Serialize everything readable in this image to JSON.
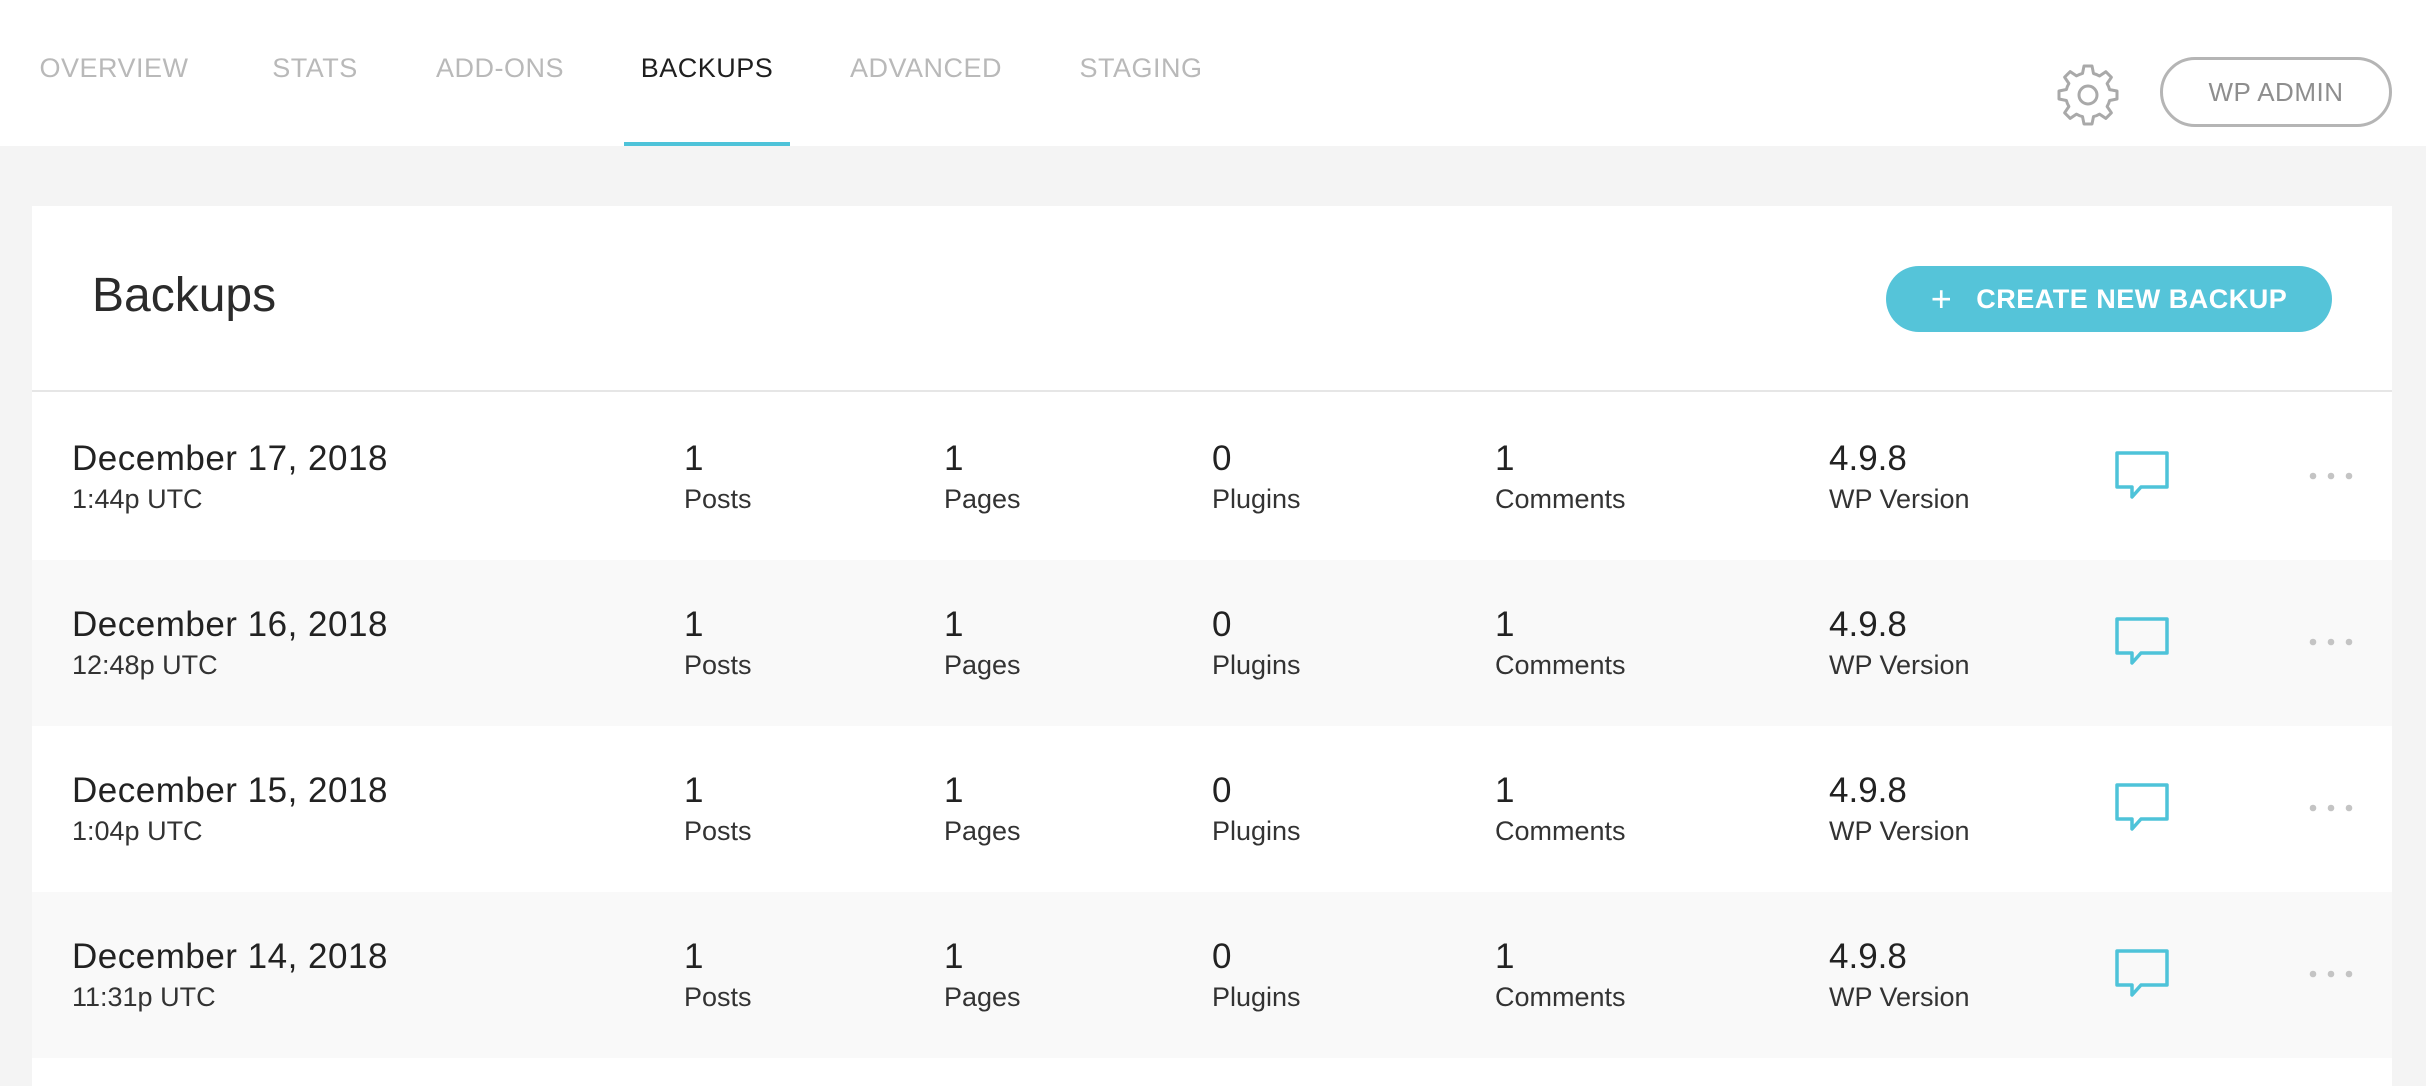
{
  "nav": {
    "tabs": [
      {
        "label": "OVERVIEW"
      },
      {
        "label": "STATS"
      },
      {
        "label": "ADD-ONS"
      },
      {
        "label": "BACKUPS"
      },
      {
        "label": "ADVANCED"
      },
      {
        "label": "STAGING"
      }
    ],
    "active_tab": "BACKUPS",
    "wp_admin_label": "WP ADMIN",
    "settings_icon": "gear-icon"
  },
  "colors": {
    "accent": "#55c4d9",
    "tab_inactive": "#b9b9b9",
    "row_alt": "#f9f9f9"
  },
  "backups": {
    "title": "Backups",
    "create_label": "CREATE NEW BACKUP",
    "create_icon": "plus-icon",
    "rows": [
      {
        "date": "December 17, 2018",
        "time": "1:44p UTC",
        "posts": "1",
        "posts_label": "Posts",
        "pages": "1",
        "pages_label": "Pages",
        "plugins": "0",
        "plugins_label": "Plugins",
        "comments": "1",
        "comments_label": "Comments",
        "wp_version": "4.9.8",
        "wp_version_label": "WP Version"
      },
      {
        "date": "December 16, 2018",
        "time": "12:48p UTC",
        "posts": "1",
        "posts_label": "Posts",
        "pages": "1",
        "pages_label": "Pages",
        "plugins": "0",
        "plugins_label": "Plugins",
        "comments": "1",
        "comments_label": "Comments",
        "wp_version": "4.9.8",
        "wp_version_label": "WP Version"
      },
      {
        "date": "December 15, 2018",
        "time": "1:04p UTC",
        "posts": "1",
        "posts_label": "Posts",
        "pages": "1",
        "pages_label": "Pages",
        "plugins": "0",
        "plugins_label": "Plugins",
        "comments": "1",
        "comments_label": "Comments",
        "wp_version": "4.9.8",
        "wp_version_label": "WP Version"
      },
      {
        "date": "December 14, 2018",
        "time": "11:31p UTC",
        "posts": "1",
        "posts_label": "Posts",
        "pages": "1",
        "pages_label": "Pages",
        "plugins": "0",
        "plugins_label": "Plugins",
        "comments": "1",
        "comments_label": "Comments",
        "wp_version": "4.9.8",
        "wp_version_label": "WP Version"
      }
    ]
  }
}
